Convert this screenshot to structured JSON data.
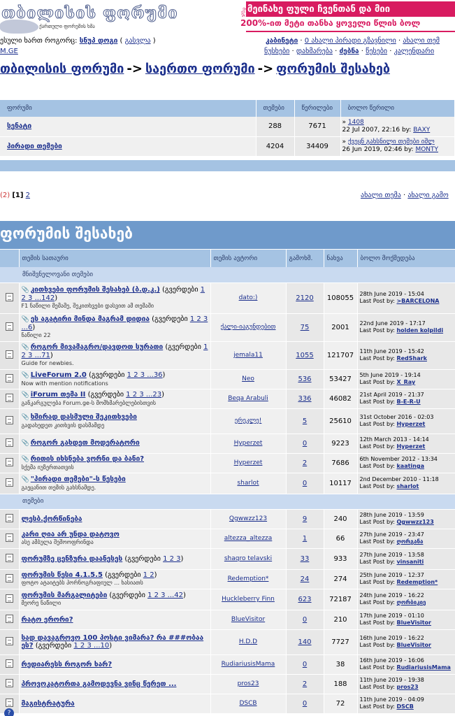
{
  "header": {
    "logo_title": "თბილისის ფორუმი",
    "logo_subtitle": "ქართული ფორუმის ხმა",
    "banner_badge": "რეკლამა",
    "banner_line1": "მეინახე ფული ჩვენთან და მიი",
    "banner_line2": "200%-ით მეტი თანხა ყოველი წლის ბოლ"
  },
  "userbar": {
    "prefix": "ესული ხართ როგორც: ",
    "username": "სნუპ დოგი",
    "logout_open": " ( ",
    "logout": "გასვლა",
    "logout_close": " )",
    "site": "M.GE"
  },
  "nav_top": {
    "cabinet": "კაბინეტი",
    "sep1": " · ",
    "new_pm": "0 ახალი პირადი გზავნილი",
    "sep2": " · ",
    "new_topics": "ახალი თემ"
  },
  "nav_bottom": {
    "list": "ნუსხები",
    "sep1": " · ",
    "help": "დახმარება",
    "sep2": " · ",
    "search": "ძებნა",
    "sep3": " · ",
    "rules": "წესები",
    "sep4": " · ",
    "calendar": "კალენდარი"
  },
  "breadcrumb": {
    "item1": "თბილისის ფორუმი",
    "arrow1": "->",
    "item2": "საერთო ფორუმი",
    "arrow2": "->",
    "item3": "ფორუმის შესახებ"
  },
  "subforums": {
    "headers": [
      "ფორუმი",
      "თემები",
      "წერილები",
      "ბოლო წერილი"
    ],
    "rows": [
      {
        "name": "სენატი",
        "topics": "288",
        "posts": "7671",
        "last_title": "1408",
        "last_date": "22 Jul 2007, 22:16 by: ",
        "last_user": "BAXY"
      },
      {
        "name": "პირადი თემები",
        "topics": "4204",
        "posts": "34409",
        "last_title": "ქვეყნ გახსნილი თემები იშლ",
        "last_date": "26 Jun 2019, 02:46 by: ",
        "last_user": "MONTY"
      }
    ]
  },
  "pager": {
    "prefix": "(2) ",
    "current": "[1]",
    "page2": "2",
    "new_topic": "ახალი თემა",
    "sep": " · ",
    "new_poll": "ახალი გამო"
  },
  "section_title": "ფორუმის შესახებ",
  "topics_table": {
    "headers": [
      "თემის სათაური",
      "თემის ავტორი",
      "გამოხმ.",
      "ნახვა",
      "ბოლო მოქმედება"
    ],
    "group_important": "მნიშვნელოვანი თემები",
    "group_topics": "თემები",
    "last_by": "Last Post by: ",
    "pages_open": "(გვერდები ",
    "pages_close": ")",
    "pinned": [
      {
        "title": "კითხვები ფორუმის შესახებ (ბ.დ.კ.)",
        "pages": "1 2 3 ...142",
        "desc": "F1 ნაწილი მემამე, შეკითხვები დასვით ამ თემაში",
        "author": "dato:)",
        "replies": "2120",
        "views": "108055",
        "date": "28th June 2019 - 15:04",
        "user": ">BARCELONA"
      },
      {
        "title": "ეს აგატირი მინდა მაგრამ დიდია",
        "pages": "1 2 3 ...6",
        "desc": "ნაწილი 22",
        "author": "ქალი-იაგუნდებით",
        "replies": "75",
        "views": "2001",
        "date": "22nd June 2019 - 17:17",
        "user": "holden kolpildi"
      },
      {
        "title": "როგორ მივამაგრო/დავდოთ სურათი",
        "pages": "1 2 3 ...71",
        "desc": "Guide for newbies.",
        "author": "jemala11",
        "replies": "1055",
        "views": "121707",
        "date": "11th June 2019 - 15:42",
        "user": "RedShark"
      },
      {
        "title": "LiveForum 2.0",
        "pages": "1 2 3 ...36",
        "desc": "Now with mention notifications",
        "author": "Neo",
        "replies": "536",
        "views": "53427",
        "date": "5th June 2019 - 19:14",
        "user": "X_Ray"
      },
      {
        "title": "iForum თემა II",
        "pages": "1 2 3 ...23",
        "desc": "განკარგულება Forum.ge-ს მომხმარებლებისთვის",
        "author": "Beqa Arabuli",
        "replies": "336",
        "views": "46082",
        "date": "21st April 2019 - 21:37",
        "user": "B-E-R-U"
      },
      {
        "title": "ხშირად დასმული შეკითხვები",
        "pages": "",
        "desc": "გადახედეთ კითხვის დასმამდე",
        "author": "ერეკლე!",
        "replies": "5",
        "views": "25610",
        "date": "31st October 2016 - 02:03",
        "user": "Hyperzet"
      },
      {
        "title": "როგორ გახდეთ მოდერატორი",
        "pages": "",
        "desc": "",
        "author": "Hyperzet",
        "replies": "0",
        "views": "9223",
        "date": "12th March 2013 - 14:14",
        "user": "Hyperzet"
      },
      {
        "title": "რითის იხსნება ვორნი და ბანი?",
        "pages": "",
        "desc": "სქემა იუზერთათვის",
        "author": "Hyperzet",
        "replies": "2",
        "views": "7686",
        "date": "6th November 2012 - 13:34",
        "user": "kaatinga"
      },
      {
        "title": "\"პირადი თემები\"-ს წესები",
        "pages": "",
        "desc": "გაეცანით თემის გახსნამდე.",
        "author": "sharlot",
        "replies": "0",
        "views": "10117",
        "date": "2nd December 2010 - 11:18",
        "user": "sharlot"
      }
    ],
    "regular": [
      {
        "title": "ლესბ.ქორწინება",
        "pages": "",
        "desc": "",
        "author": "Qgwwzz123",
        "replies": "9",
        "views": "240",
        "date": "28th June 2019 - 13:59",
        "user": "Qgwwzz123"
      },
      {
        "title": "კარი ღია არ უნდა დატოვო",
        "pages": "",
        "desc": "ასე ამბულა შეშოოფრინდა",
        "author": "altezza_altezza",
        "replies": "1",
        "views": "66",
        "date": "27th June 2019 - 23:47",
        "user": "ღორგანა"
      },
      {
        "title": "ფორუმზე ცენზურა დაანესეს",
        "pages": "1 2 3",
        "desc": "",
        "author": "shaqro telavski",
        "replies": "33",
        "views": "933",
        "date": "27th June 2019 - 13:58",
        "user": "vinsaniti"
      },
      {
        "title": "ფორუმის წესი 4.1.5.5",
        "pages": "1 2",
        "desc": "ფოტო ატაიტებს პორნოგრაფიულ ... ხასიათს",
        "author": "Redemption*",
        "replies": "24",
        "views": "274",
        "date": "25th June 2019 - 12:37",
        "user": "Redemption*"
      },
      {
        "title": "ფორუმის მარგალიტები",
        "pages": "1 2 3 ...42",
        "desc": "მეორე ნაწილი",
        "author": "Huckleberry Finn",
        "replies": "623",
        "views": "72187",
        "date": "24th June 2019 - 16:22",
        "user": "ღორბიკიე"
      },
      {
        "title": "რატო ერორი?",
        "pages": "",
        "desc": "",
        "author": "BlueVisitor",
        "replies": "0",
        "views": "210",
        "date": "17th June 2019 - 01:10",
        "user": "BlueVisitor"
      },
      {
        "title": "სად დავაგროვო 100 პოსტი ვიმარა? რა ###ობაა ეს?",
        "pages": "1 2 3 ...10",
        "desc": "",
        "author": "H.D.D",
        "replies": "140",
        "views": "7727",
        "date": "16th June 2019 - 16:22",
        "user": "BlueVisitor"
      },
      {
        "title": "რედიარესს როგორ ხარ?",
        "pages": "",
        "desc": "",
        "author": "RudiariusisMama",
        "replies": "0",
        "views": "38",
        "date": "16th June 2019 - 16:06",
        "user": "RudiariusisMama"
      },
      {
        "title": "პროვოკატორთა გამოდევნა ვინც წერეთ ...",
        "pages": "",
        "desc": "",
        "author": "pros23",
        "replies": "2",
        "views": "188",
        "date": "11th June 2019 - 19:38",
        "user": "pros23"
      },
      {
        "title": "მაგისტრატურა",
        "pages": "",
        "desc": "",
        "author": "DSCB",
        "replies": "0",
        "views": "72",
        "date": "11th June 2019 - 04:09",
        "user": "DSCB"
      }
    ]
  },
  "help_icon": "?"
}
